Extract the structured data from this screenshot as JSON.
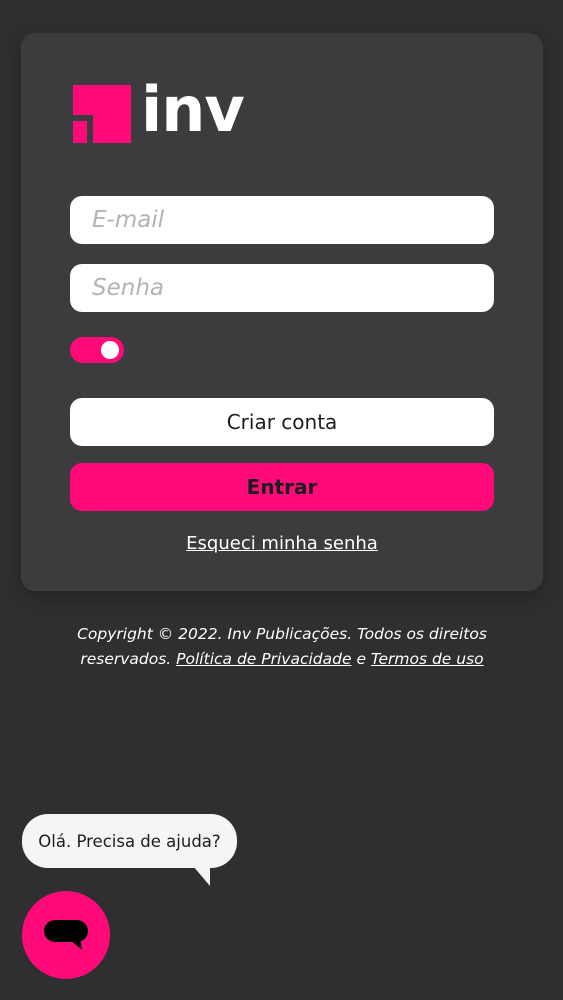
{
  "brand": {
    "name": "inv",
    "accent_color": "#ff0a78",
    "logo_icon": "inv-logo-icon"
  },
  "login": {
    "email_placeholder": "E-mail",
    "password_placeholder": "Senha",
    "remember_toggle_on": true,
    "create_account_label": "Criar conta",
    "enter_label": "Entrar",
    "forgot_password_label": "Esqueci minha senha"
  },
  "footer": {
    "copyright": "Copyright © 2022. Inv Publicações. Todos os direitos reservados.",
    "privacy_label": "Política de Privacidade",
    "conjunction": "e",
    "terms_label": "Termos de uso"
  },
  "chat": {
    "bubble_text": "Olá. Precisa de ajuda?",
    "button_icon": "chat-bubble-icon"
  }
}
